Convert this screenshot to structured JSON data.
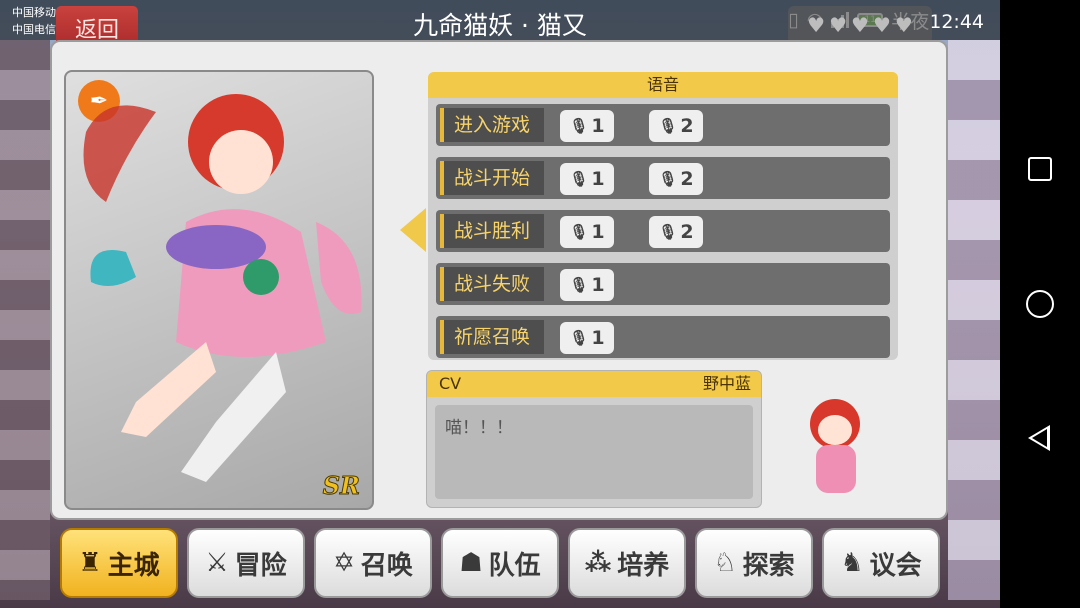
{
  "status_bar": {
    "carrier1": "中国移动4G",
    "carrier2": "中国电信",
    "battery": "11",
    "time": "半夜12:44"
  },
  "header": {
    "back_label": "返回",
    "title": "九命猫妖 · 猫又"
  },
  "card": {
    "rarity": "SR",
    "type_icon": "pen-nib-icon"
  },
  "voice": {
    "header": "语音",
    "rows": [
      {
        "label": "进入游戏",
        "buttons": [
          "1",
          "2"
        ]
      },
      {
        "label": "战斗开始",
        "buttons": [
          "1",
          "2"
        ]
      },
      {
        "label": "战斗胜利",
        "buttons": [
          "1",
          "2"
        ]
      },
      {
        "label": "战斗失败",
        "buttons": [
          "1"
        ]
      },
      {
        "label": "祈愿召唤",
        "buttons": [
          "1"
        ]
      }
    ]
  },
  "cv": {
    "label": "CV",
    "name": "野中蓝",
    "line": "喵！！！"
  },
  "nav": {
    "items": [
      {
        "label": "主城",
        "icon": "castle-icon",
        "active": true
      },
      {
        "label": "冒险",
        "icon": "crossed-swords-icon",
        "active": false
      },
      {
        "label": "召唤",
        "icon": "hexagram-icon",
        "active": false
      },
      {
        "label": "队伍",
        "icon": "mask-icon",
        "active": false
      },
      {
        "label": "培养",
        "icon": "triple-circle-icon",
        "active": false
      },
      {
        "label": "探索",
        "icon": "explorer-icon",
        "active": false
      },
      {
        "label": "议会",
        "icon": "dragon-icon",
        "active": false
      }
    ]
  },
  "colors": {
    "accent_yellow": "#f3c94a",
    "back_red": "#b8332f",
    "active_nav": "#f5c234"
  }
}
